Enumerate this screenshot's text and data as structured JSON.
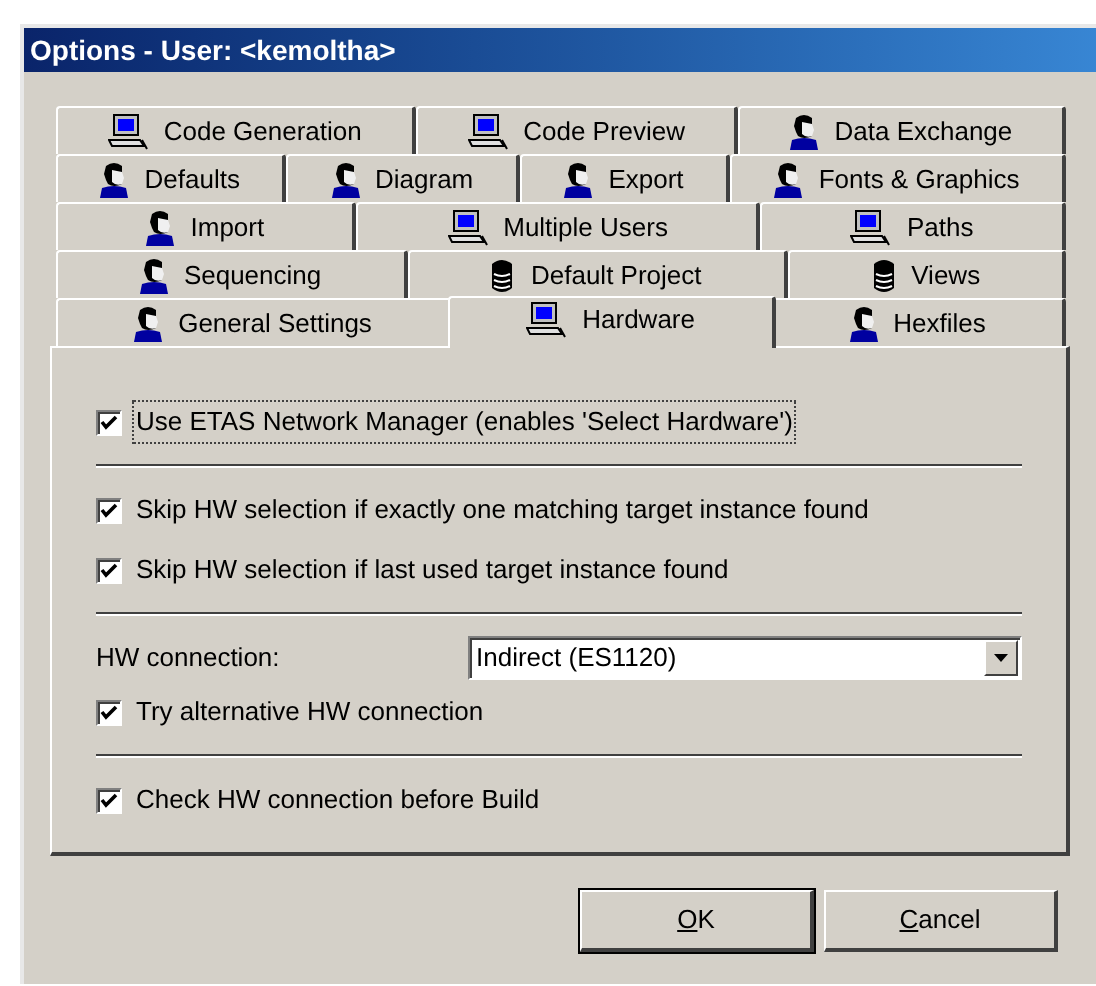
{
  "window": {
    "title": "Options - User: <kemoltha>"
  },
  "tab_rows": [
    [
      {
        "label": "Code Generation",
        "kind": "computer",
        "selected": false
      },
      {
        "label": "Code Preview",
        "kind": "computer",
        "selected": false
      },
      {
        "label": "Data Exchange",
        "kind": "user",
        "selected": false
      }
    ],
    [
      {
        "label": "Defaults",
        "kind": "user",
        "selected": false
      },
      {
        "label": "Diagram",
        "kind": "user",
        "selected": false
      },
      {
        "label": "Export",
        "kind": "user",
        "selected": false
      },
      {
        "label": "Fonts & Graphics",
        "kind": "user",
        "selected": false
      }
    ],
    [
      {
        "label": "Import",
        "kind": "user",
        "selected": false
      },
      {
        "label": "Multiple Users",
        "kind": "computer",
        "selected": false
      },
      {
        "label": "Paths",
        "kind": "computer",
        "selected": false
      }
    ],
    [
      {
        "label": "Sequencing",
        "kind": "user",
        "selected": false
      },
      {
        "label": "Default Project",
        "kind": "database",
        "selected": false
      },
      {
        "label": "Views",
        "kind": "database",
        "selected": false
      }
    ],
    [
      {
        "label": "General Settings",
        "kind": "user",
        "selected": false
      },
      {
        "label": "Hardware",
        "kind": "computer",
        "selected": true
      },
      {
        "label": "Hexfiles",
        "kind": "user",
        "selected": false
      }
    ]
  ],
  "items": [
    {
      "kind": "checkbox",
      "label": "Use ETAS Network Manager (enables 'Select Hardware')",
      "checked": true,
      "focused": true
    },
    {
      "kind": "divider"
    },
    {
      "kind": "checkbox",
      "label": "Skip HW selection if exactly one matching target instance found",
      "checked": true,
      "focused": false
    },
    {
      "kind": "checkbox",
      "label": "Skip HW selection if last used target instance found",
      "checked": true,
      "focused": false
    },
    {
      "kind": "divider"
    },
    {
      "kind": "dropdown",
      "label": "HW connection:",
      "value": "Indirect (ES1120)"
    },
    {
      "kind": "checkbox",
      "label": "Try alternative HW connection",
      "checked": true,
      "focused": false
    },
    {
      "kind": "divider"
    },
    {
      "kind": "checkbox",
      "label": "Check HW connection before Build",
      "checked": true,
      "focused": false
    }
  ],
  "buttons": [
    {
      "label": "OK",
      "access_key_underlined": true,
      "default": true
    },
    {
      "label": "Cancel",
      "access_key_underlined": true,
      "default": false
    }
  ]
}
